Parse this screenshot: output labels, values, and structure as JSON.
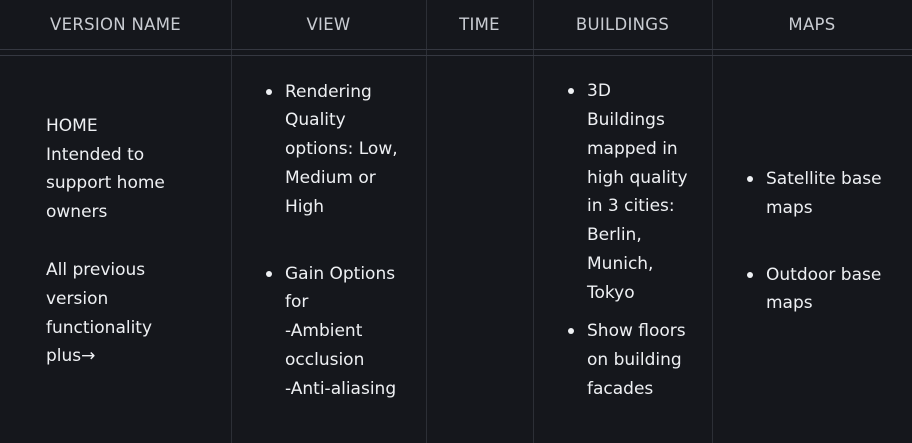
{
  "headers": {
    "version_name": "VERSION NAME",
    "view": "VIEW",
    "time": "TIME",
    "buildings": "BUILDINGS",
    "maps": "MAPS"
  },
  "version_cell": {
    "name": "HOME",
    "desc_1": "Intended to",
    "desc_2": "support home",
    "desc_3": "owners",
    "prev_1": "All previous",
    "prev_2": "version",
    "prev_3": "functionality",
    "prev_4": "plus→"
  },
  "view_cell": {
    "item1_lines": [
      "Rendering",
      "Quality",
      "options: Low,",
      "Medium or",
      "High"
    ],
    "item2_lines": [
      "Gain Options",
      "for",
      "-Ambient",
      "occlusion",
      "-Anti-aliasing"
    ]
  },
  "time_cell": {},
  "buildings_cell": {
    "item1_lines": [
      "3D",
      "Buildings",
      "mapped in",
      "high quality",
      "in 3 cities:",
      "Berlin,",
      "Munich,",
      "Tokyo"
    ],
    "item2_lines": [
      "Show floors",
      "on building",
      "facades"
    ]
  },
  "maps_cell": {
    "item1_lines": [
      "Satellite base",
      "maps"
    ],
    "item2_lines": [
      "Outdoor base",
      "maps"
    ]
  },
  "colors": {
    "background": "#15171c",
    "grid_line": "#2c2f36",
    "header_text": "#c9ccd2",
    "body_text": "#eef0f3"
  }
}
